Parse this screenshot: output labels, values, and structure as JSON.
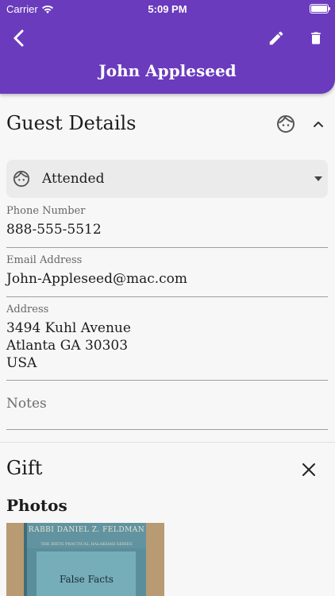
{
  "status_bar": {
    "carrier": "Carrier",
    "time": "5:09 PM"
  },
  "header": {
    "title": "John Appleseed"
  },
  "guest_details": {
    "title": "Guest Details",
    "status_value": "Attended",
    "fields": {
      "phone": {
        "label": "Phone Number",
        "value": "888-555-5512"
      },
      "email": {
        "label": "Email Address",
        "value": "John-Appleseed@mac.com"
      },
      "address": {
        "label": "Address",
        "value": "3494 Kuhl Avenue\nAtlanta GA 30303\nUSA"
      },
      "notes": {
        "placeholder": "Notes"
      }
    }
  },
  "gift": {
    "title": "Gift",
    "photos_title": "Photos",
    "book": {
      "author": "RABBI DANIEL Z. FELDMAN",
      "series": "THE RIETS PRACTICAL HALAKHAH SERIES",
      "title": "False Facts"
    }
  },
  "colors": {
    "header": "#6a3bbd",
    "background": "#f7f7f7"
  },
  "icons": [
    "wifi-icon",
    "battery-icon",
    "back-arrow-icon",
    "pencil-icon",
    "trash-icon",
    "face-icon",
    "chevron-up-icon",
    "caret-down-icon",
    "close-icon"
  ]
}
